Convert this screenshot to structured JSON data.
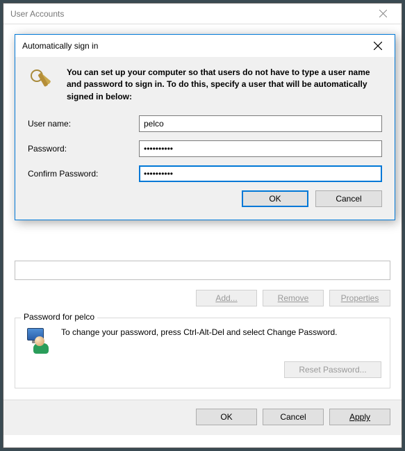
{
  "parent": {
    "title": "User Accounts",
    "buttons": {
      "add": "Add...",
      "remove": "Remove",
      "properties": "Properties"
    },
    "passwordGroup": {
      "legend": "Password for pelco",
      "text": "To change your password, press Ctrl-Alt-Del and select Change Password.",
      "reset": "Reset Password..."
    },
    "footer": {
      "ok": "OK",
      "cancel": "Cancel",
      "apply": "Apply"
    }
  },
  "modal": {
    "title": "Automatically sign in",
    "description": "You can set up your computer so that users do not have to type a user name and password to sign in. To do this, specify a user that will be automatically signed in below:",
    "fields": {
      "usernameLabel": "User name:",
      "usernameValue": "pelco",
      "passwordLabel": "Password:",
      "passwordValue": "••••••••••",
      "confirmLabel": "Confirm Password:",
      "confirmValue": "••••••••••"
    },
    "buttons": {
      "ok": "OK",
      "cancel": "Cancel"
    }
  }
}
